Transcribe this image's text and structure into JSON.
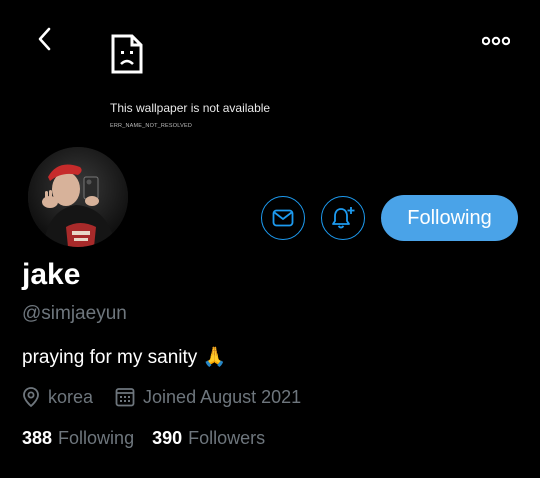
{
  "banner": {
    "error_message": "This wallpaper is not available",
    "error_code": "ERR_NAME_NOT_RESOLVED"
  },
  "actions": {
    "follow_label": "Following"
  },
  "profile": {
    "name": "jake",
    "handle": "@simjaeyun",
    "bio": "praying for my sanity 🙏",
    "location": "korea",
    "joined": "Joined August 2021"
  },
  "stats": {
    "following_count": "388",
    "following_label": "Following",
    "followers_count": "390",
    "followers_label": "Followers"
  },
  "colors": {
    "background": "#000000",
    "accent": "#1d9bf0",
    "follow_button": "#4aa3e8",
    "muted_text": "#6e767d"
  }
}
